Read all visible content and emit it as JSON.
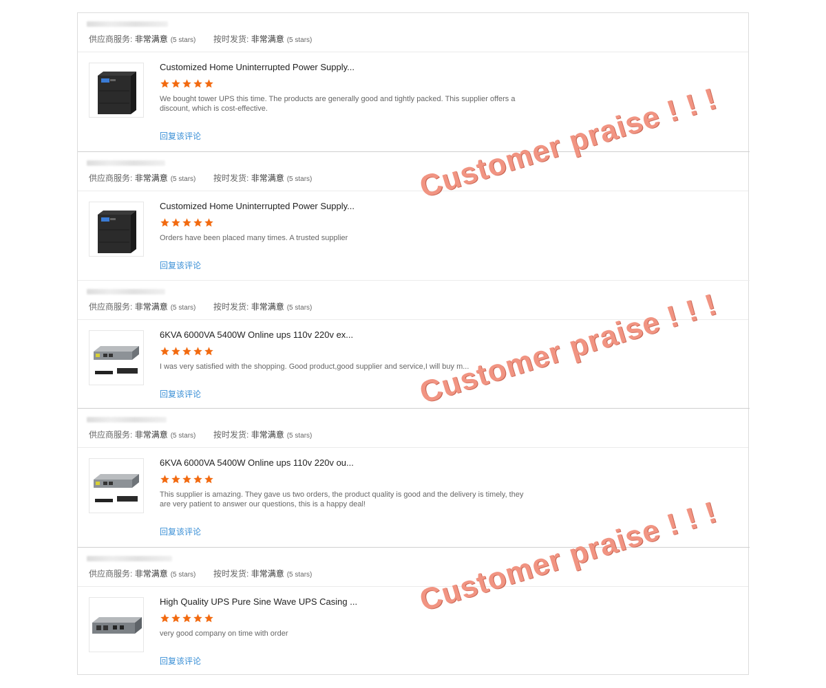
{
  "labels": {
    "supplier_service": "供应商服务:",
    "on_time": "按时发货:",
    "rating_value": "非常满意",
    "stars_text": "(5 stars)",
    "reply": "回复该评论"
  },
  "watermark_text": "Customer praise ! ! !",
  "reviews": [
    {
      "product_title": "Customized Home Uninterrupted Power Supply...",
      "rating": 5,
      "text": "We bought tower UPS this time. The products are generally good and tightly packed. This supplier offers a discount, which is cost-effective."
    },
    {
      "product_title": "Customized Home Uninterrupted Power Supply...",
      "rating": 5,
      "text": "Orders have been placed many times. A trusted supplier"
    },
    {
      "product_title": "6KVA 6000VA 5400W Online ups 110v 220v ex...",
      "rating": 5,
      "text": "I was very satisfied with the shopping. Good product,good supplier and service,I will buy m..."
    },
    {
      "product_title": "6KVA 6000VA 5400W Online ups 110v 220v ou...",
      "rating": 5,
      "text": "This supplier is amazing. They gave us two orders, the product quality is good and the delivery is timely, they are very patient to answer our questions, this is a happy deal!"
    },
    {
      "product_title": "High Quality UPS Pure Sine Wave UPS Casing ...",
      "rating": 5,
      "text": "very good company on time with order"
    }
  ],
  "colors": {
    "star": "#f26a10",
    "link": "#3a8fd6",
    "watermark": "#f08c78"
  }
}
